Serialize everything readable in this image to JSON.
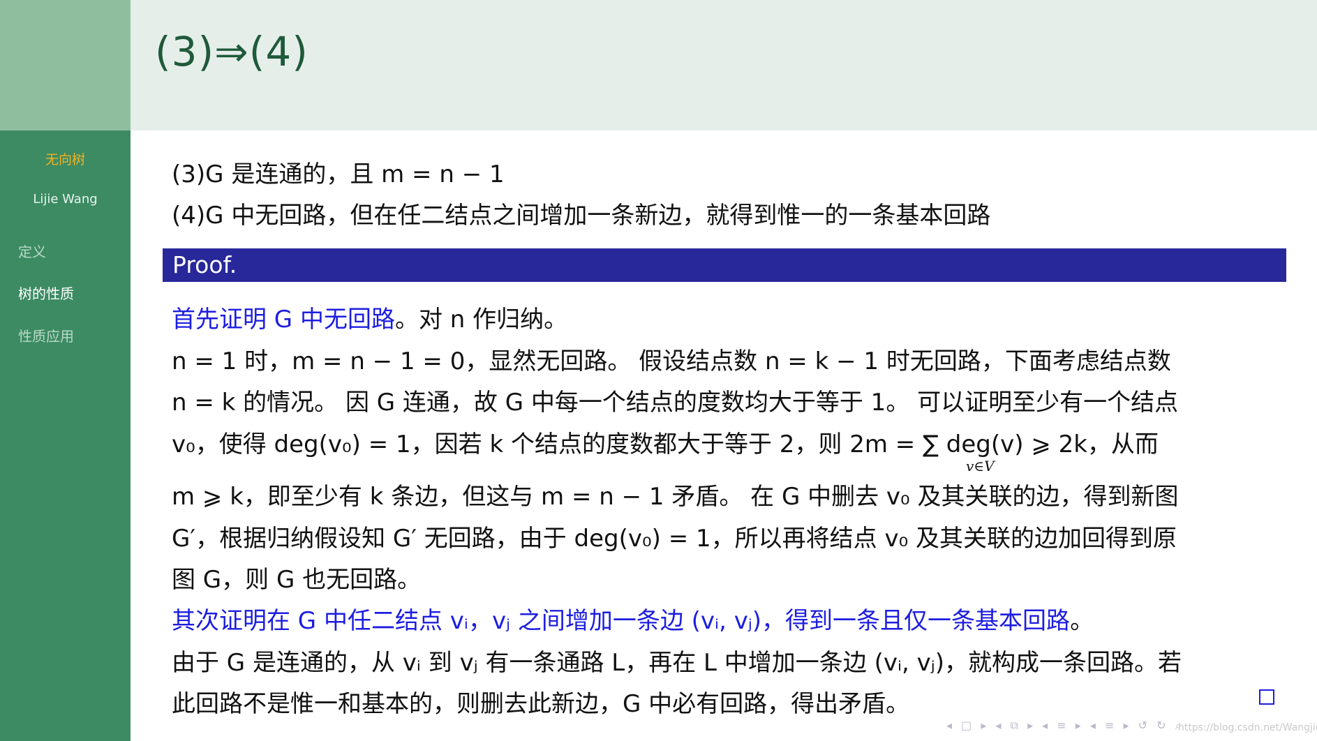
{
  "header": {
    "title": "(3)⇒(4)"
  },
  "sidebar": {
    "section_title": "无向树",
    "author": "Lijie Wang",
    "items": [
      {
        "label": "定义",
        "active": false
      },
      {
        "label": "树的性质",
        "active": true
      },
      {
        "label": "性质应用",
        "active": false
      }
    ]
  },
  "statements": {
    "s3": "(3)G 是连通的，且 m = n − 1",
    "s4": "(4)G 中无回路，但在任二结点之间增加一条新边，就得到惟一的一条基本回路"
  },
  "proof": {
    "label": "Proof.",
    "lines": [
      {
        "segments": [
          {
            "text": "首先证明 G 中无回路",
            "color": "blue"
          },
          {
            "text": "。对 n 作归纳。",
            "color": "black"
          }
        ]
      },
      {
        "segments": [
          {
            "text": "n = 1 时，m = n − 1 = 0，显然无回路。  假设结点数 n = k − 1 时无回路，下面考虑结点数",
            "color": "black"
          }
        ]
      },
      {
        "segments": [
          {
            "text": "n = k 的情况。 因 G 连通，故 G 中每一个结点的度数均大于等于 1。 可以证明至少有一个结点",
            "color": "black"
          }
        ]
      },
      {
        "segments": [
          {
            "text": "v₀，使得 deg(v₀) = 1，因若 k 个结点的度数都大于等于 2，则 2m = ∑ deg(v) ⩾ 2k，从而",
            "color": "black"
          }
        ]
      },
      {
        "segments": [
          {
            "text": "m ⩾ k，即至少有 k 条边，但这与 m = n − 1 矛盾。 在 G 中删去 v₀ 及其关联的边，得到新图",
            "color": "black"
          }
        ]
      },
      {
        "segments": [
          {
            "text": "G′，根据归纳假设知 G′ 无回路，由于 deg(v₀) = 1，所以再将结点 v₀ 及其关联的边加回得到原",
            "color": "black"
          }
        ]
      },
      {
        "segments": [
          {
            "text": "图 G，则 G 也无回路。",
            "color": "black"
          }
        ]
      },
      {
        "segments": [
          {
            "text": "其次证明在 G 中任二结点 vᵢ，vⱼ 之间增加一条边 (vᵢ, vⱼ)，得到一条且仅一条基本回路",
            "color": "blue"
          },
          {
            "text": "。",
            "color": "black"
          }
        ]
      },
      {
        "segments": [
          {
            "text": "由于 G 是连通的，从 vᵢ 到 vⱼ 有一条通路 L，再在 L 中增加一条边 (vᵢ, vⱼ)，就构成一条回路。若",
            "color": "black"
          }
        ]
      },
      {
        "segments": [
          {
            "text": "此回路不是惟一和基本的，则删去此新边，G 中必有回路，得出矛盾。",
            "color": "black"
          }
        ]
      }
    ],
    "sum_subscript": "v∈V"
  },
  "footer": {
    "nav_icons": [
      "nav-frame-icon",
      "nav-subsection-icon",
      "nav-section-icon",
      "nav-slide-icon",
      "undo-icon",
      "search-icon"
    ],
    "nav_glyphs": "◂ □ ▸ ◂ ⧉ ▸ ◂ ≡ ▸ ◂ ≡ ▸ ↺ ↻ ⌕",
    "watermark": "https://blog.csdn.net/Wangjie..."
  },
  "colors": {
    "sidebar_dark": "#3c8b63",
    "sidebar_light": "#8fbe9f",
    "header_bg": "#e6eeea",
    "title": "#1f5a3a",
    "section_title": "#f4b224",
    "proof_bar": "#28289a",
    "highlight_blue": "#1d1de0"
  }
}
